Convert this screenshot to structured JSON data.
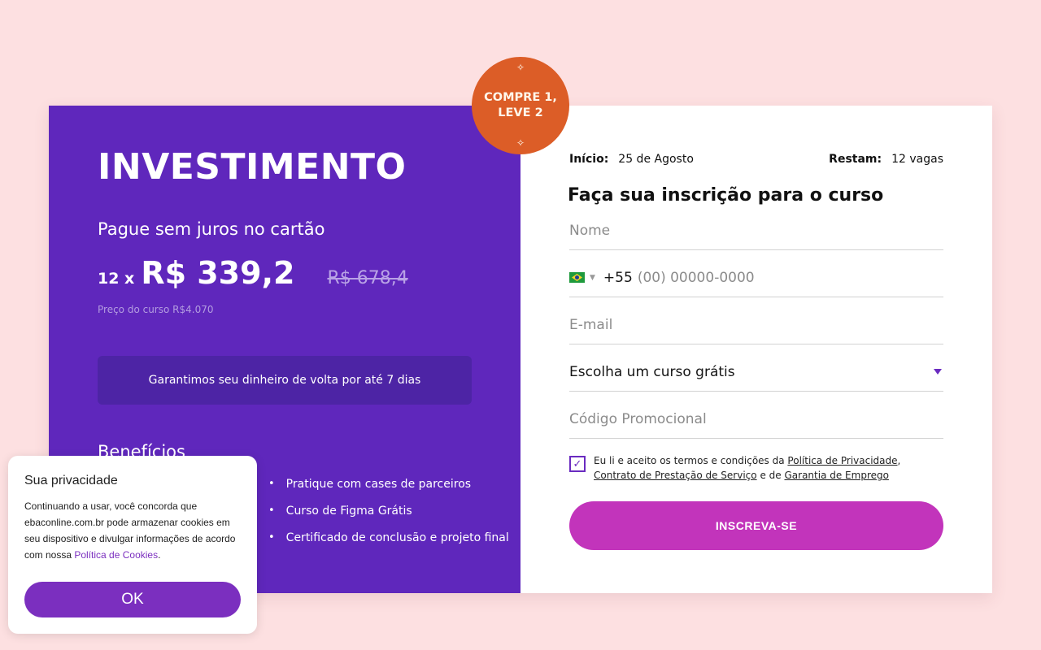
{
  "colors": {
    "background": "#fde0e1",
    "left_panel": "#5f27bc",
    "guarantee_box": "#4d24a5",
    "badge": "#dc5d27",
    "submit_button": "#c234bb",
    "cookie_button": "#7b2fbf"
  },
  "badge": {
    "line1": "COMPRE 1,",
    "line2": "LEVE 2",
    "star": "✧"
  },
  "investment": {
    "title": "INVESTIMENTO",
    "subtitle": "Pague sem juros no cartão",
    "installments": "12 x",
    "price": "R$ 339,2",
    "old_price": "R$ 678,4",
    "course_price": "Preço do curso R$4.070",
    "guarantee": "Garantimos seu dinheiro de volta por até 7 dias",
    "benefits_title": "Benefícios",
    "benefits": [
      "Pratique com cases de parceiros",
      "Curso de Figma Grátis",
      "Certificado de conclusão e projeto final"
    ]
  },
  "form": {
    "start_label": "Início:",
    "start_value": "25 de Agosto",
    "remaining_label": "Restam:",
    "remaining_value": "12 vagas",
    "title": "Faça sua inscrição para o curso",
    "name_placeholder": "Nome",
    "phone_flag": "brazil-flag-icon",
    "phone_code": "+55",
    "phone_placeholder": "(00) 00000-0000",
    "email_placeholder": "E-mail",
    "course_select": "Escolha um curso grátis",
    "promo_placeholder": "Código Promocional",
    "terms_checked": true,
    "terms_prefix": "Eu li e aceito os termos e condições da",
    "terms_link1": "Política de Privacidade",
    "terms_sep1": ",",
    "terms_link2": "Contrato de Prestação de Serviço",
    "terms_sep2": "e de",
    "terms_link3": "Garantia de Emprego",
    "submit": "INSCREVA-SE"
  },
  "cookie": {
    "title": "Sua privacidade",
    "text": "Continuando a usar, você concorda que ebaconline.com.br pode armazenar cookies em seu dispositivo e divulgar informações de acordo com nossa",
    "link": "Política de Cookies",
    "period": ".",
    "ok": "OK"
  }
}
